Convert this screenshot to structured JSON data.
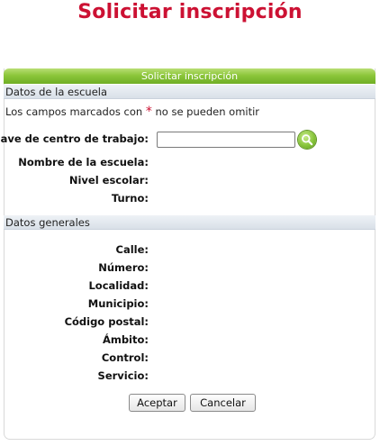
{
  "page": {
    "title": "Solicitar inscripción"
  },
  "panel": {
    "header": "Solicitar inscripción",
    "required_marker": "*",
    "note_before": "Los campos marcados con",
    "note_after": "no se pueden omitir"
  },
  "school_section": {
    "title": "Datos de la escuela",
    "clave_label": "Clave de centro de trabajo:",
    "clave_value": "",
    "clave_placeholder": "",
    "search_icon": "search-icon",
    "fields": [
      {
        "label": "Nombre de la escuela:",
        "value": ""
      },
      {
        "label": "Nivel escolar:",
        "value": ""
      },
      {
        "label": "Turno:",
        "value": ""
      }
    ]
  },
  "general_section": {
    "title": "Datos generales",
    "fields": [
      {
        "label": "Calle:",
        "value": ""
      },
      {
        "label": "Número:",
        "value": ""
      },
      {
        "label": "Localidad:",
        "value": ""
      },
      {
        "label": "Municipio:",
        "value": ""
      },
      {
        "label": "Código postal:",
        "value": ""
      },
      {
        "label": "Ámbito:",
        "value": ""
      },
      {
        "label": "Control:",
        "value": ""
      },
      {
        "label": "Servicio:",
        "value": ""
      }
    ]
  },
  "actions": {
    "accept_label": "Aceptar",
    "cancel_label": "Cancelar"
  },
  "colors": {
    "title_red": "#cc1133",
    "header_green": "#8cc63a",
    "section_gray": "#dde3ea"
  }
}
